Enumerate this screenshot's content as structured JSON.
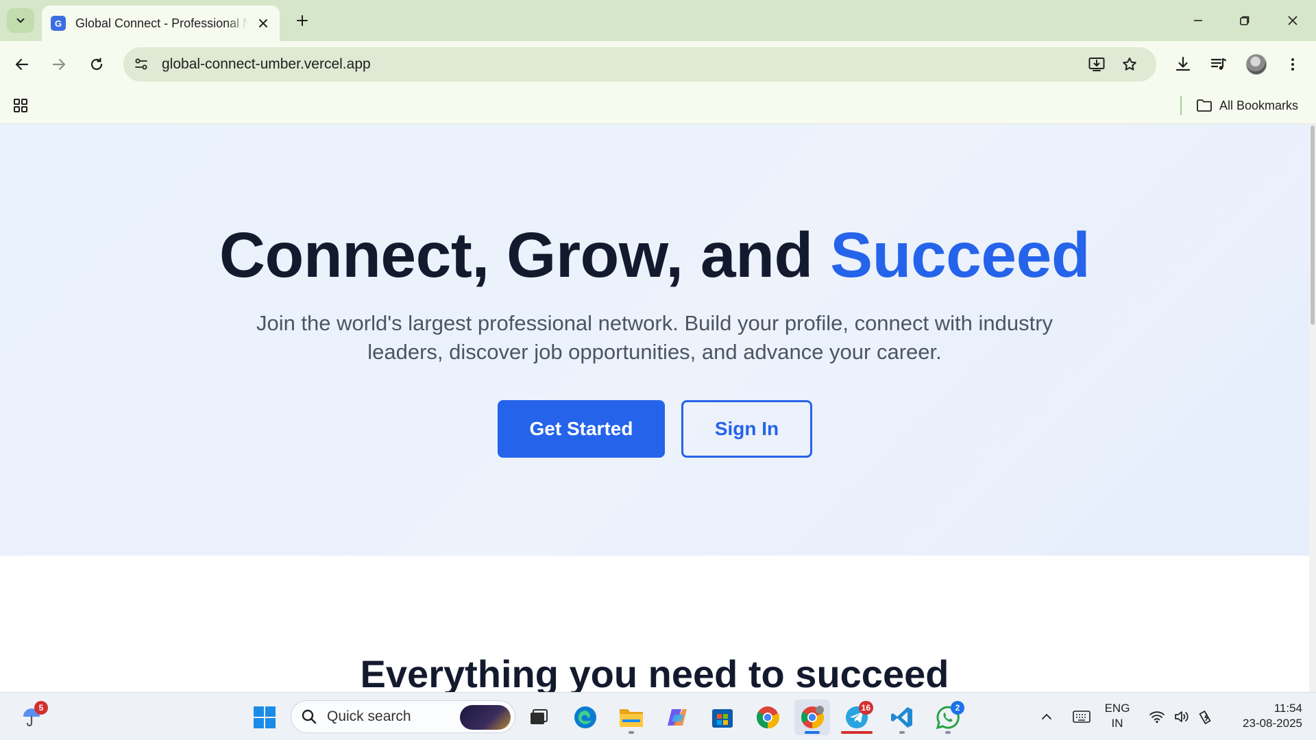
{
  "browser": {
    "tab": {
      "favicon_letter": "G",
      "title": "Global Connect - Professional Network"
    },
    "url": "global-connect-umber.vercel.app",
    "bookmarks_label": "All Bookmarks",
    "accent_color": "#d6e6c8"
  },
  "hero": {
    "title_main": "Connect, Grow, and ",
    "title_accent": "Succeed",
    "subtitle": "Join the world's largest professional network. Build your profile, connect with industry leaders, discover job opportunities, and advance your career.",
    "primary_button": "Get Started",
    "secondary_button": "Sign In",
    "brand_color": "#2563eb"
  },
  "features": {
    "title": "Everything you need to succeed"
  },
  "taskbar": {
    "weather_badge": "5",
    "search_placeholder": "Quick search",
    "telegram_badge": "16",
    "whatsapp_badge": "2",
    "lang_line1": "ENG",
    "lang_line2": "IN",
    "time": "11:54",
    "date": "23-08-2025"
  }
}
